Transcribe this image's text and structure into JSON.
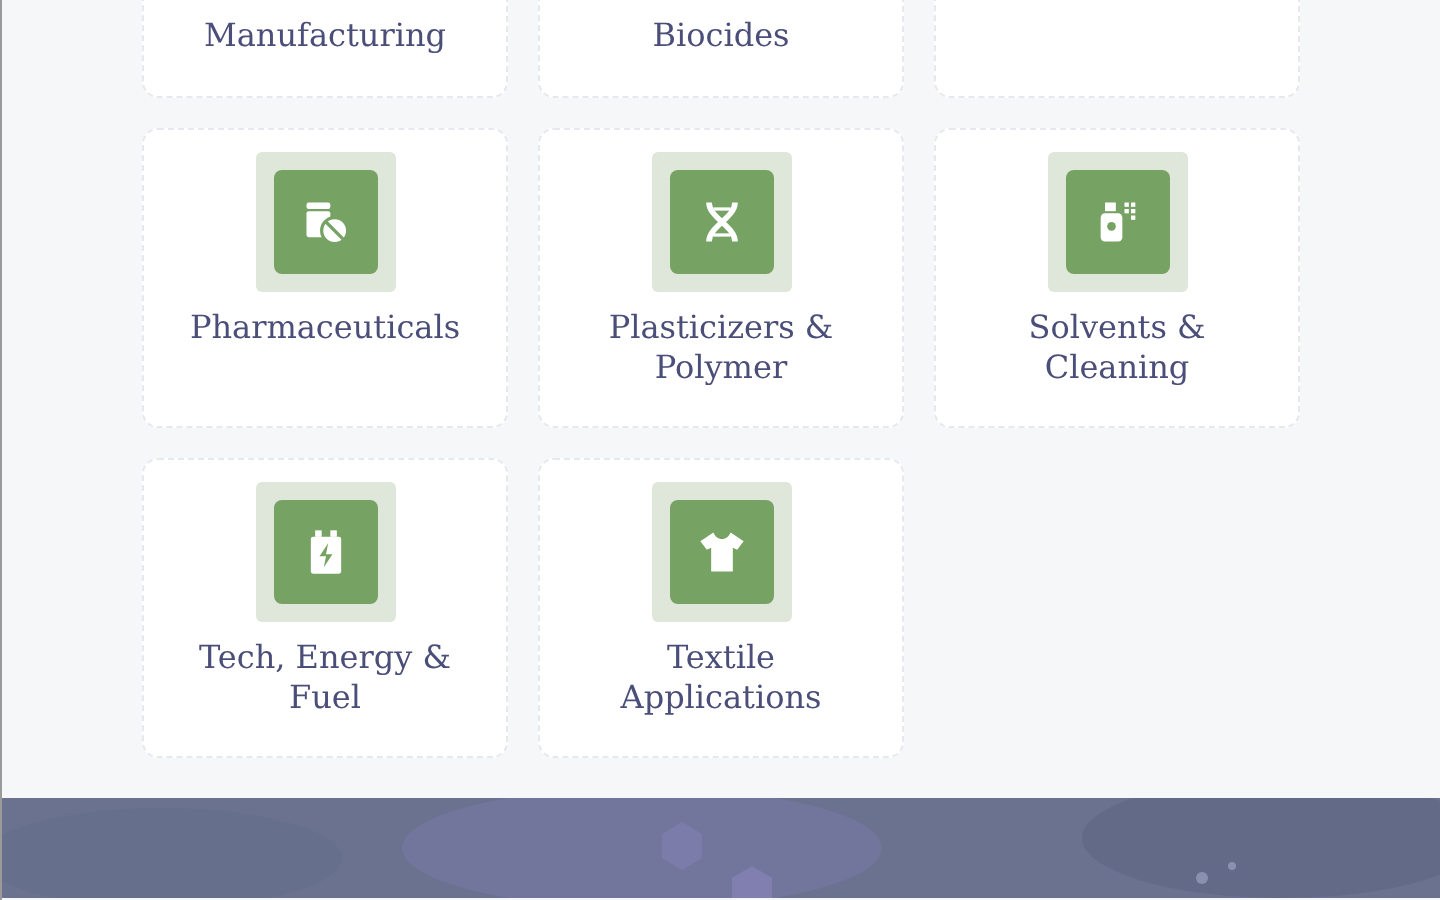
{
  "cut_cards": [
    {
      "kind": "labelled",
      "label": "Manufacturing"
    },
    {
      "kind": "labelled",
      "label": "Biocides"
    },
    {
      "kind": "blank"
    }
  ],
  "cards": [
    {
      "label": "Pharmaceuticals"
    },
    {
      "label": "Plasticizers &\nPolymer"
    },
    {
      "label": "Solvents &\nCleaning"
    },
    {
      "label": "Tech, Energy &\nFuel"
    },
    {
      "label": "Textile\nApplications"
    }
  ]
}
